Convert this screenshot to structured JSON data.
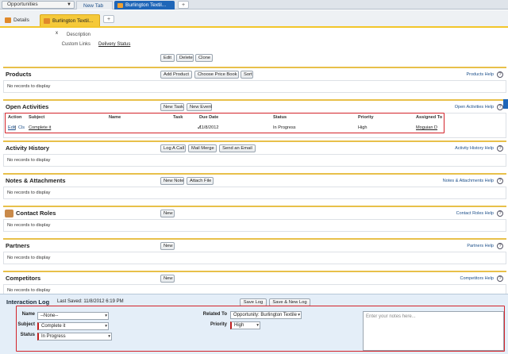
{
  "top": {
    "app_select": "Opportunities",
    "tabs": [
      "New Tab",
      "Burlington Textil..."
    ],
    "plus": "+"
  },
  "subtabs": {
    "details": "Details",
    "record": "Burlington Textil...",
    "close": "x",
    "plus": "+"
  },
  "detail": {
    "description_label": "Description",
    "custom_links_label": "Custom Links",
    "custom_link": "Delivery Status",
    "buttons": [
      "Edit",
      "Delete",
      "Clone"
    ]
  },
  "lists": {
    "products": {
      "title": "Products",
      "buttons": [
        "Add Product",
        "Choose Price Book",
        "Sort"
      ],
      "help": "Products Help",
      "empty": "No records to display"
    },
    "open_activities": {
      "title": "Open Activities",
      "buttons": [
        "New Task",
        "New Event"
      ],
      "help": "Open Activities Help",
      "headers": [
        "Action",
        "Subject",
        "Name",
        "Task",
        "Due Date",
        "Status",
        "Priority",
        "Assigned To"
      ],
      "row": {
        "action_edit": "Edit",
        "action_sep": "|",
        "action_cls": "Cls",
        "subject": "Complete it",
        "name": "",
        "task": "✓",
        "due": "11/8/2012",
        "status": "In Progress",
        "priority": "High",
        "assigned": "Moguian D"
      }
    },
    "activity_history": {
      "title": "Activity History",
      "buttons": [
        "Log A Call",
        "Mail Merge",
        "Send an Email"
      ],
      "help": "Activity History Help",
      "empty": "No records to display"
    },
    "notes": {
      "title": "Notes & Attachments",
      "buttons": [
        "New Note",
        "Attach File"
      ],
      "help": "Notes & Attachments Help",
      "empty": "No records to display"
    },
    "contact_roles": {
      "title": "Contact Roles",
      "buttons": [
        "New"
      ],
      "help": "Contact Roles Help",
      "empty": "No records to display"
    },
    "partners": {
      "title": "Partners",
      "buttons": [
        "New"
      ],
      "help": "Partners Help",
      "empty": "No records to display"
    },
    "competitors": {
      "title": "Competitors",
      "buttons": [
        "New"
      ],
      "help": "Competitors Help",
      "empty": "No records to display"
    }
  },
  "help_q": "?",
  "interaction_log": {
    "title": "Interaction Log",
    "last_saved": "Last Saved: 11/8/2012 6:19 PM",
    "save_log": "Save Log",
    "save_new_log": "Save & New Log",
    "name_label": "Name",
    "name_value": "--None--",
    "subject_label": "Subject",
    "subject_value": "Complete it",
    "status_label": "Status",
    "status_value": "In Progress",
    "related_label": "Related To",
    "related_value": "Opportunity: Burlington Textile",
    "priority_label": "Priority",
    "priority_value": "High",
    "notes_placeholder": "Enter your notes here..."
  },
  "colors": {
    "accent_blue": "#1f66b8",
    "highlight_red": "#d3232a",
    "section_gold": "#e8c04a"
  }
}
